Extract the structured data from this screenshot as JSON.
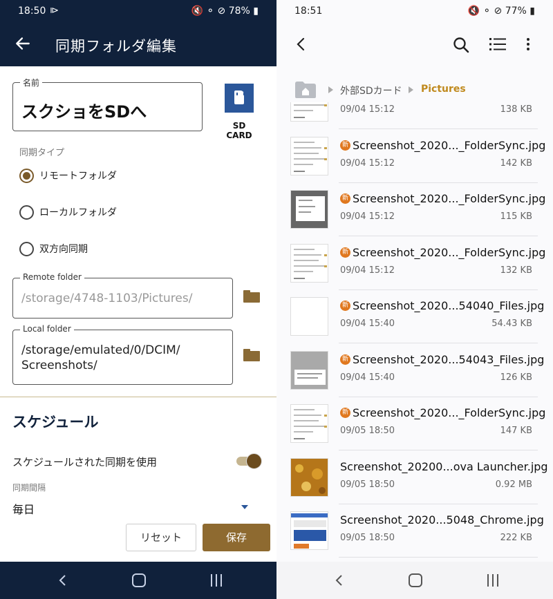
{
  "left": {
    "status": {
      "time": "18:50",
      "sync_indicator": "⧐",
      "system": "🔇 ⚬ ⊘ 78% ▮"
    },
    "appbar": {
      "title": "同期フォルダ編集"
    },
    "name_field": {
      "label": "名前",
      "value": "スクショをSDへ"
    },
    "sd_card": {
      "label": "SD CARD"
    },
    "sync_type": {
      "label": "同期タイプ",
      "options": [
        "リモートフォルダ",
        "ローカルフォルダ",
        "双方向同期"
      ],
      "selected": "リモートフォルダ"
    },
    "remote_folder": {
      "label": "Remote folder",
      "value": "/storage/4748-1103/Pictures/"
    },
    "local_folder": {
      "label": "Local folder",
      "value_line1": "/storage/emulated/0/DCIM/",
      "value_line2": "Screenshots/"
    },
    "schedule": {
      "heading": "スケジュール",
      "use_label": "スケジュールされた同期を使用",
      "use_enabled": true,
      "interval_label": "同期間隔",
      "interval_value": "毎日"
    },
    "buttons": {
      "reset": "リセット",
      "save": "保存"
    }
  },
  "right": {
    "status": {
      "time": "18:51",
      "system": "🔇 ⚬ ⊘ 77% ▮"
    },
    "breadcrumb": {
      "sd": "外部SDカード",
      "current": "Pictures"
    },
    "colors": {
      "accent": "#c08a1e",
      "new_badge": "#e0781f"
    },
    "files": [
      {
        "name": "",
        "date": "09/04 15:12",
        "size": "138 KB",
        "is_new": false,
        "thumb": "doc"
      },
      {
        "name": "Screenshot_2020..._FolderSync.jpg",
        "date": "09/04 15:12",
        "size": "142 KB",
        "is_new": true,
        "thumb": "doc"
      },
      {
        "name": "Screenshot_2020..._FolderSync.jpg",
        "date": "09/04 15:12",
        "size": "115 KB",
        "is_new": true,
        "thumb": "dialog"
      },
      {
        "name": "Screenshot_2020..._FolderSync.jpg",
        "date": "09/04 15:12",
        "size": "132 KB",
        "is_new": true,
        "thumb": "doc"
      },
      {
        "name": "Screenshot_2020...54040_Files.jpg",
        "date": "09/04 15:40",
        "size": "54.43 KB",
        "is_new": true,
        "thumb": "blank"
      },
      {
        "name": "Screenshot_2020...54043_Files.jpg",
        "date": "09/04 15:40",
        "size": "126 KB",
        "is_new": true,
        "thumb": "gray"
      },
      {
        "name": "Screenshot_2020..._FolderSync.jpg",
        "date": "09/05 18:50",
        "size": "147 KB",
        "is_new": true,
        "thumb": "doc"
      },
      {
        "name": "Screenshot_20200...ova Launcher.jpg",
        "date": "09/05 18:50",
        "size": "0.92 MB",
        "is_new": false,
        "thumb": "gold"
      },
      {
        "name": "Screenshot_2020...5048_Chrome.jpg",
        "date": "09/05 18:50",
        "size": "222 KB",
        "is_new": false,
        "thumb": "web"
      }
    ],
    "new_badge_label": "新"
  }
}
